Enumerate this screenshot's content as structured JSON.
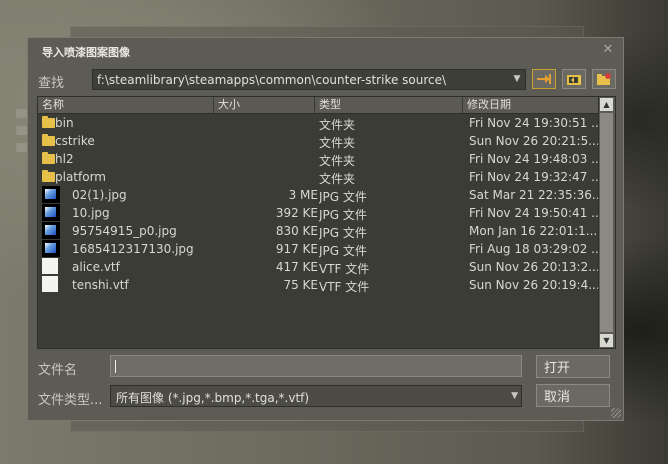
{
  "dialog": {
    "title": "导入喷漆图案图像",
    "close_icon": "close-icon"
  },
  "lookin": {
    "label": "查找",
    "path": "f:\\steamlibrary\\steamapps\\common\\counter-strike source\\"
  },
  "toolbar": {
    "buttons": [
      "up-folder-icon",
      "desktop-folder-icon",
      "new-folder-icon"
    ]
  },
  "columns": [
    "名称",
    "大小",
    "类型",
    "修改日期"
  ],
  "files": [
    {
      "name": "bin",
      "size": "",
      "type": "文件夹",
      "date": "Fri Nov 24 19:30:51 ...",
      "icon": "folder"
    },
    {
      "name": "cstrike",
      "size": "",
      "type": "文件夹",
      "date": "Sun Nov 26 20:21:5...",
      "icon": "folder"
    },
    {
      "name": "hl2",
      "size": "",
      "type": "文件夹",
      "date": "Fri Nov 24 19:48:03 ...",
      "icon": "folder"
    },
    {
      "name": "platform",
      "size": "",
      "type": "文件夹",
      "date": "Fri Nov 24 19:32:47 ...",
      "icon": "folder"
    },
    {
      "name": "02(1).jpg",
      "size": "3 ME",
      "type": "JPG 文件",
      "date": "Sat Mar 21 22:35:36...",
      "icon": "image"
    },
    {
      "name": "10.jpg",
      "size": "392 KE",
      "type": "JPG 文件",
      "date": "Fri Nov 24 19:50:41 ...",
      "icon": "image"
    },
    {
      "name": "95754915_p0.jpg",
      "size": "830 KE",
      "type": "JPG 文件",
      "date": "Mon Jan 16 22:01:1...",
      "icon": "image"
    },
    {
      "name": "1685412317130.jpg",
      "size": "917 KE",
      "type": "JPG 文件",
      "date": "Fri Aug 18 03:29:02 ...",
      "icon": "image"
    },
    {
      "name": "alice.vtf",
      "size": "417 KE",
      "type": "VTF 文件",
      "date": "Sun Nov 26 20:13:2...",
      "icon": "vtf"
    },
    {
      "name": "tenshi.vtf",
      "size": "75 KE",
      "type": "VTF 文件",
      "date": "Sun Nov 26 20:19:4...",
      "icon": "vtf"
    }
  ],
  "filename": {
    "label": "文件名",
    "value": "",
    "open_label": "打开"
  },
  "filetype": {
    "label": "文件类型...",
    "selected": "所有图像 (*.jpg,*.bmp,*.tga,*.vtf)",
    "cancel_label": "取消"
  }
}
